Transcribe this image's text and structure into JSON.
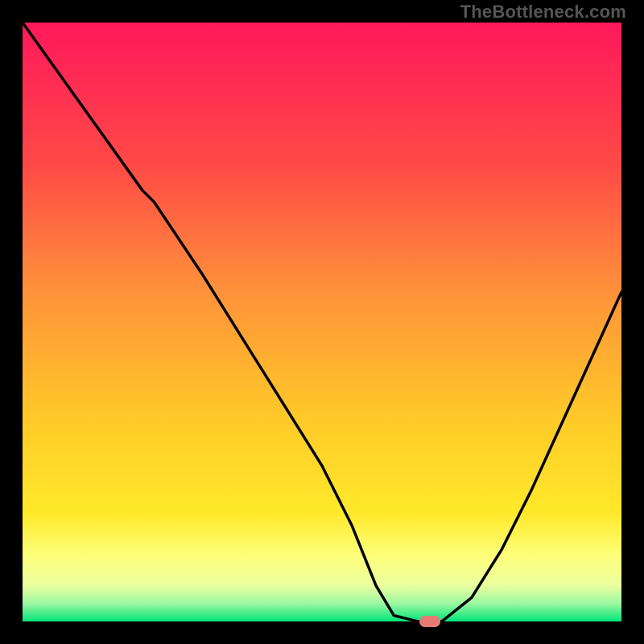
{
  "attribution": "TheBottleneck.com",
  "colors": {
    "top": "#ff185b",
    "mid1": "#ff6a3b",
    "mid2": "#ffb426",
    "mid3": "#ffe627",
    "yellowband": "#feff7b",
    "pale": "#eaff9e",
    "green": "#00e57a",
    "marker": "#e77b74",
    "frame": "#000000"
  },
  "chart_data": {
    "type": "line",
    "title": "",
    "xlabel": "",
    "ylabel": "",
    "xlim": [
      0,
      100
    ],
    "ylim": [
      0,
      100
    ],
    "x": [
      0,
      5,
      10,
      15,
      20,
      22,
      30,
      40,
      50,
      55,
      59,
      62,
      66,
      70,
      75,
      80,
      85,
      90,
      95,
      100
    ],
    "values": [
      100,
      93,
      86,
      79,
      72,
      70,
      58,
      42,
      26,
      16,
      6,
      1,
      0,
      0,
      4,
      12,
      22,
      33,
      44,
      55
    ],
    "marker": {
      "x": 68,
      "y": 0
    },
    "note": "Values estimated from pixel positions; y is relative bottleneck % (0 = optimal, 100 = worst)."
  }
}
